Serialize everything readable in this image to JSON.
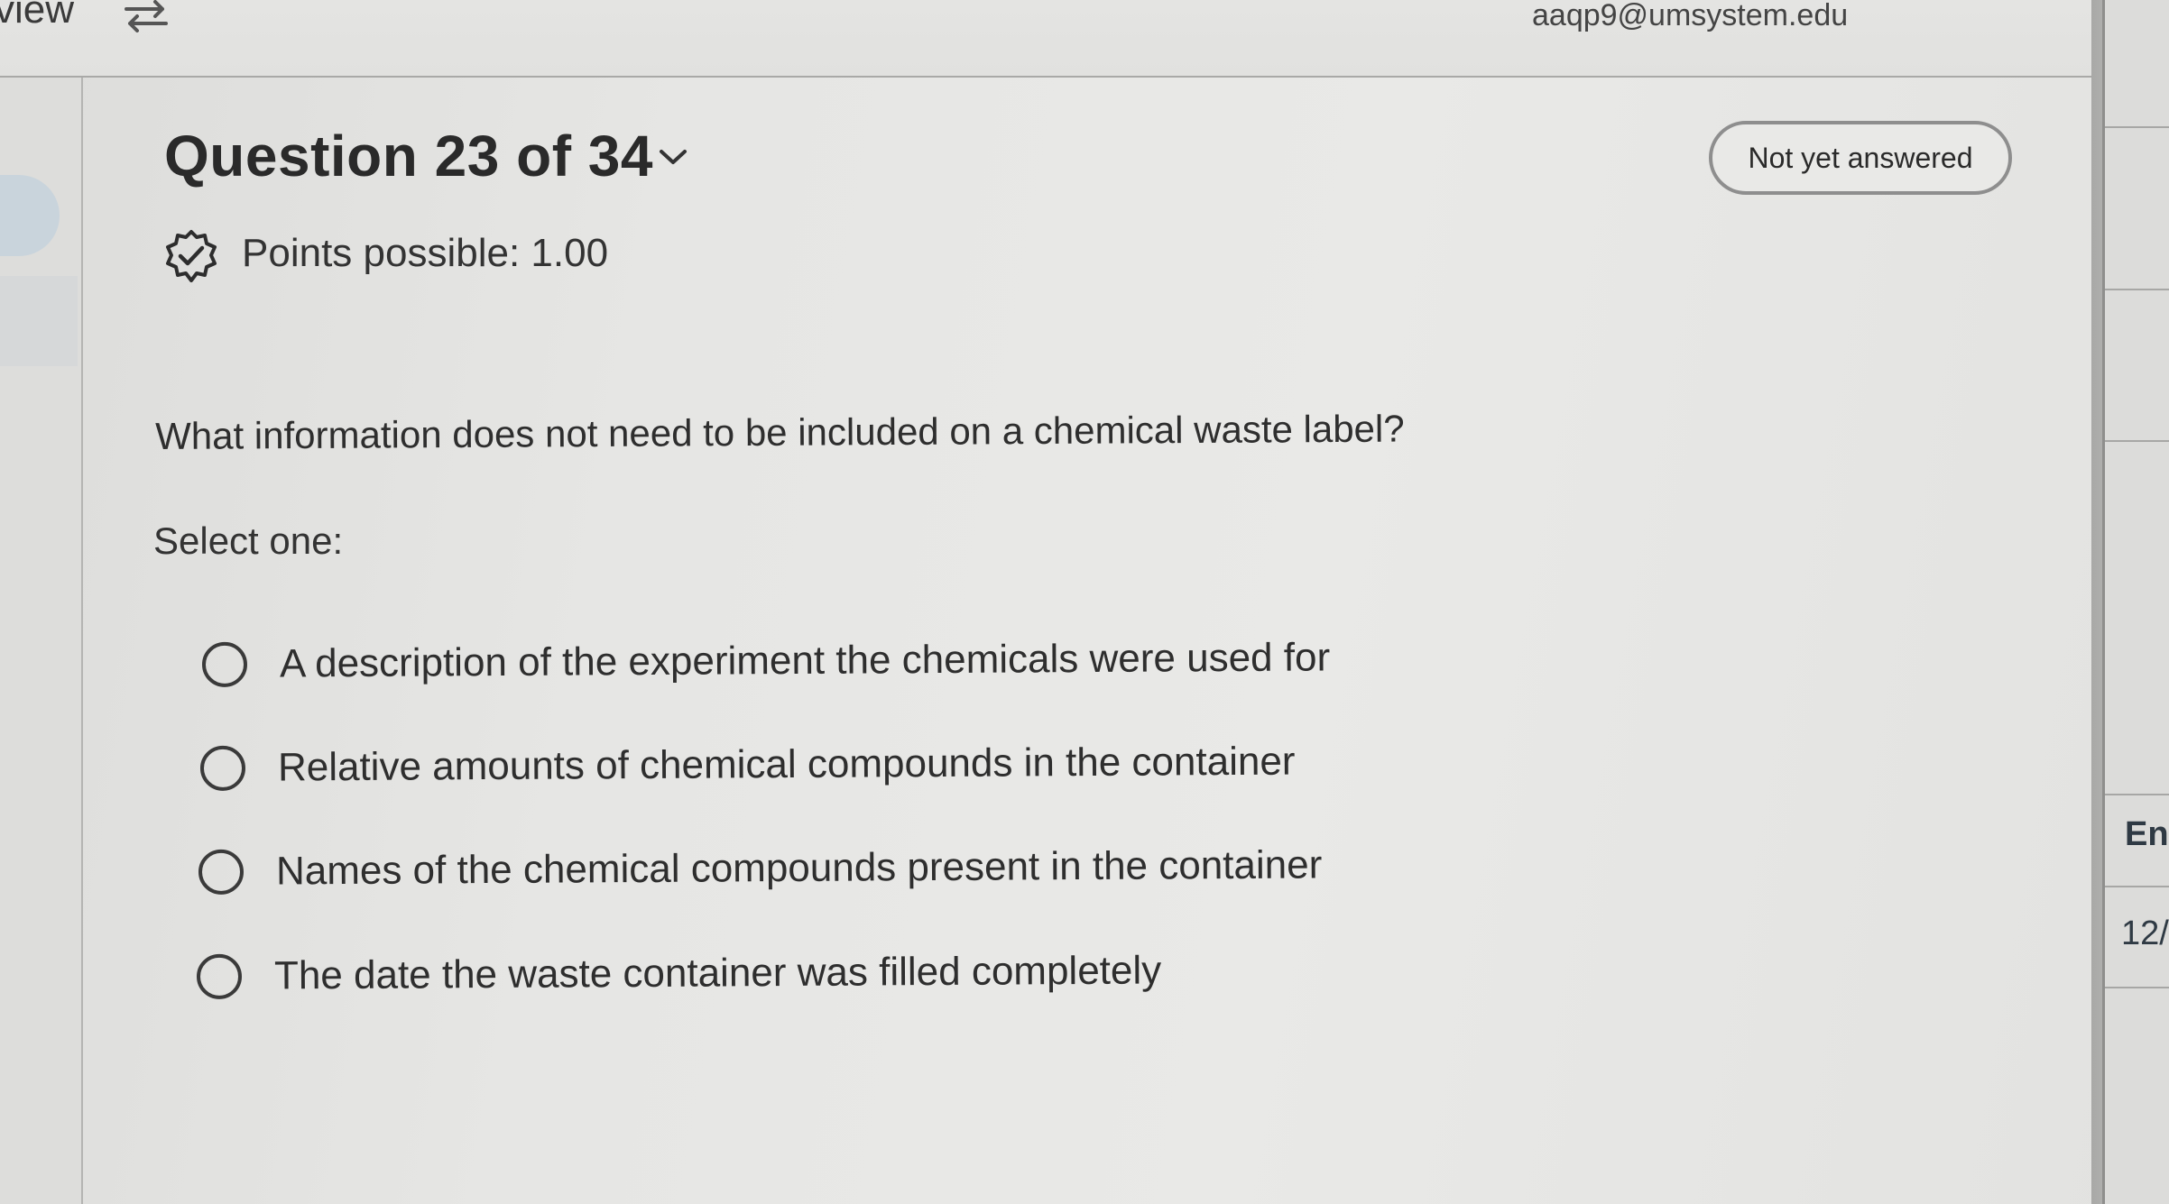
{
  "header": {
    "view_label": "view",
    "swap_icon": "swap-arrows-icon",
    "user_email": "aaqp9@umsystem.edu"
  },
  "question": {
    "title": "Question 23 of 34",
    "chevron_icon": "chevron-down-icon",
    "status": "Not yet answered",
    "points_icon": "verified-badge-icon",
    "points": "Points possible: 1.00",
    "text": "What information does not need to be included on a chemical waste label?",
    "select_prompt": "Select one:",
    "options": [
      {
        "label": "A description of the experiment the chemicals were used for",
        "selected": false
      },
      {
        "label": "Relative amounts of chemical compounds in the container",
        "selected": false
      },
      {
        "label": "Names of the chemical compounds present in the container",
        "selected": false
      },
      {
        "label": "The date the waste container was filled completely",
        "selected": false
      }
    ]
  },
  "right_panel": {
    "label_fragment": "En",
    "date_fragment": "12/"
  },
  "colors": {
    "background": "#e6e6e4",
    "text": "#2b2b2b",
    "badge_border": "#8e8e8e",
    "left_accent": "#c9d4dc"
  }
}
